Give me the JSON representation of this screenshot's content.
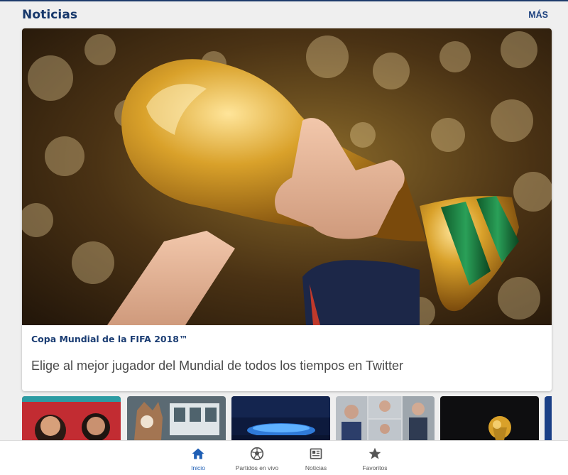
{
  "header": {
    "title": "Noticias",
    "more_label": "MÁS"
  },
  "featured": {
    "tag": "Copa Mundial de la FIFA 2018™",
    "headline": "Elige al mejor jugador del Mundial de todos los tiempos en Twitter",
    "image": "world-cup-trophy-photo"
  },
  "thumbnails": [
    {
      "image": "illustrated-players-thumbnail"
    },
    {
      "image": "mascot-wolf-thumbnail"
    },
    {
      "image": "stadium-night-thumbnail"
    },
    {
      "image": "coaches-collage-thumbnail"
    },
    {
      "image": "trophy-dark-thumbnail"
    }
  ],
  "bottom_nav": {
    "items": [
      {
        "label": "Inicio",
        "icon": "home-icon",
        "active": true
      },
      {
        "label": "Partidos en vivo",
        "icon": "football-icon",
        "active": false
      },
      {
        "label": "Noticias",
        "icon": "newspaper-icon",
        "active": false
      },
      {
        "label": "Favoritos",
        "icon": "star-icon",
        "active": false
      }
    ]
  },
  "colors": {
    "brand_navy": "#17386b",
    "active_blue": "#1f5fb5",
    "background": "#efefef"
  }
}
